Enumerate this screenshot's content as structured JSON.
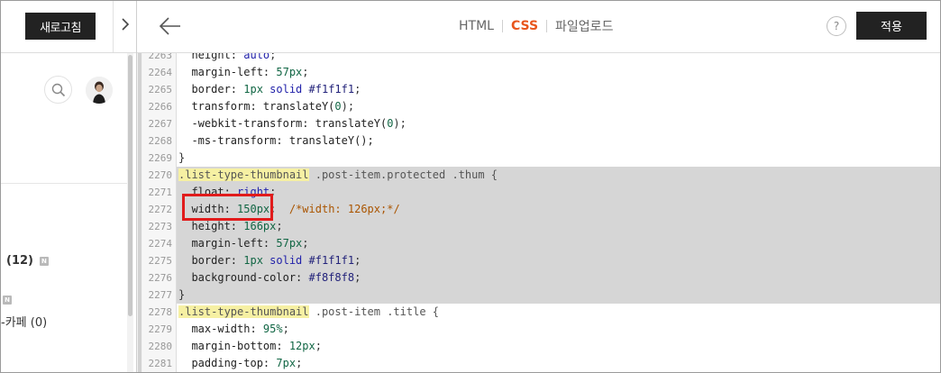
{
  "left_panel": {
    "refresh_button": "새로고침",
    "categories": [
      {
        "label": "(12)",
        "badge": "N"
      },
      {
        "label": "",
        "badge": "N"
      },
      {
        "label": "-카페 (0)"
      }
    ]
  },
  "header": {
    "tabs": [
      {
        "label": "HTML",
        "active": false
      },
      {
        "label": "CSS",
        "active": true
      },
      {
        "label": "파일업로드",
        "active": false
      }
    ],
    "help_label": "?",
    "apply_button": "적용"
  },
  "colors": {
    "accent": "#e8561e",
    "dark_button": "#222222",
    "highlight_band": "#d6d6d6",
    "selector_highlight": "#f6f0a3",
    "annotation_box": "#e11b1b"
  },
  "code": {
    "lines": [
      {
        "num": "2263",
        "segs": [
          {
            "t": "  height: ",
            "c": "prop"
          },
          {
            "t": "auto",
            "c": "kw2"
          },
          {
            "t": ";",
            "c": ""
          }
        ]
      },
      {
        "num": "2264",
        "segs": [
          {
            "t": "  margin-left: ",
            "c": "prop"
          },
          {
            "t": "57px",
            "c": "num"
          },
          {
            "t": ";",
            "c": ""
          }
        ]
      },
      {
        "num": "2265",
        "segs": [
          {
            "t": "  border: ",
            "c": "prop"
          },
          {
            "t": "1px",
            "c": "num"
          },
          {
            "t": " solid ",
            "c": "kw2"
          },
          {
            "t": "#f1f1f1",
            "c": "hex"
          },
          {
            "t": ";",
            "c": ""
          }
        ]
      },
      {
        "num": "2266",
        "segs": [
          {
            "t": "  transform: translateY(",
            "c": "prop"
          },
          {
            "t": "0",
            "c": "num"
          },
          {
            "t": ");",
            "c": ""
          }
        ]
      },
      {
        "num": "2267",
        "segs": [
          {
            "t": "  -webkit-transform: translateY(",
            "c": "prop"
          },
          {
            "t": "0",
            "c": "num"
          },
          {
            "t": ");",
            "c": ""
          }
        ]
      },
      {
        "num": "2268",
        "segs": [
          {
            "t": "  -ms-transform: translateY();",
            "c": "prop"
          }
        ]
      },
      {
        "num": "2269",
        "segs": [
          {
            "t": "}",
            "c": ""
          }
        ]
      },
      {
        "num": "2270",
        "hl": true,
        "segs": [
          {
            "t": ".list-type-thumbnail",
            "c": "sel"
          },
          {
            "t": " .post-item.protected .thum {",
            "c": "sel2"
          }
        ]
      },
      {
        "num": "2271",
        "hl": true,
        "segs": [
          {
            "t": "  float: ",
            "c": "prop"
          },
          {
            "t": "right",
            "c": "kw2"
          },
          {
            "t": ";",
            "c": ""
          }
        ]
      },
      {
        "num": "2272",
        "hl": true,
        "segs": [
          {
            "t": "  width: ",
            "c": "prop"
          },
          {
            "t": "150px",
            "c": "num"
          },
          {
            "t": ";  ",
            "c": ""
          },
          {
            "t": "/*width: 126px;*/",
            "c": "cmt"
          }
        ]
      },
      {
        "num": "2273",
        "hl": true,
        "segs": [
          {
            "t": "  height: ",
            "c": "prop"
          },
          {
            "t": "166px",
            "c": "num"
          },
          {
            "t": ";",
            "c": ""
          }
        ]
      },
      {
        "num": "2274",
        "hl": true,
        "segs": [
          {
            "t": "  margin-left: ",
            "c": "prop"
          },
          {
            "t": "57px",
            "c": "num"
          },
          {
            "t": ";",
            "c": ""
          }
        ]
      },
      {
        "num": "2275",
        "hl": true,
        "segs": [
          {
            "t": "  border: ",
            "c": "prop"
          },
          {
            "t": "1px",
            "c": "num"
          },
          {
            "t": " solid ",
            "c": "kw2"
          },
          {
            "t": "#f1f1f1",
            "c": "hex"
          },
          {
            "t": ";",
            "c": ""
          }
        ]
      },
      {
        "num": "2276",
        "hl": true,
        "segs": [
          {
            "t": "  background-color: ",
            "c": "prop"
          },
          {
            "t": "#f8f8f8",
            "c": "hex"
          },
          {
            "t": ";",
            "c": ""
          }
        ]
      },
      {
        "num": "2277",
        "hl": true,
        "segs": [
          {
            "t": "}",
            "c": ""
          }
        ]
      },
      {
        "num": "2278",
        "segs": [
          {
            "t": ".list-type-thumbnail",
            "c": "sel"
          },
          {
            "t": " .post-item .title {",
            "c": "sel2"
          }
        ]
      },
      {
        "num": "2279",
        "segs": [
          {
            "t": "  max-width: ",
            "c": "prop"
          },
          {
            "t": "95%",
            "c": "num"
          },
          {
            "t": ";",
            "c": ""
          }
        ]
      },
      {
        "num": "2280",
        "segs": [
          {
            "t": "  margin-bottom: ",
            "c": "prop"
          },
          {
            "t": "12px",
            "c": "num"
          },
          {
            "t": ";",
            "c": ""
          }
        ]
      },
      {
        "num": "2281",
        "segs": [
          {
            "t": "  padding-top: ",
            "c": "prop"
          },
          {
            "t": "7px",
            "c": "num"
          },
          {
            "t": ";",
            "c": ""
          }
        ]
      }
    ]
  }
}
